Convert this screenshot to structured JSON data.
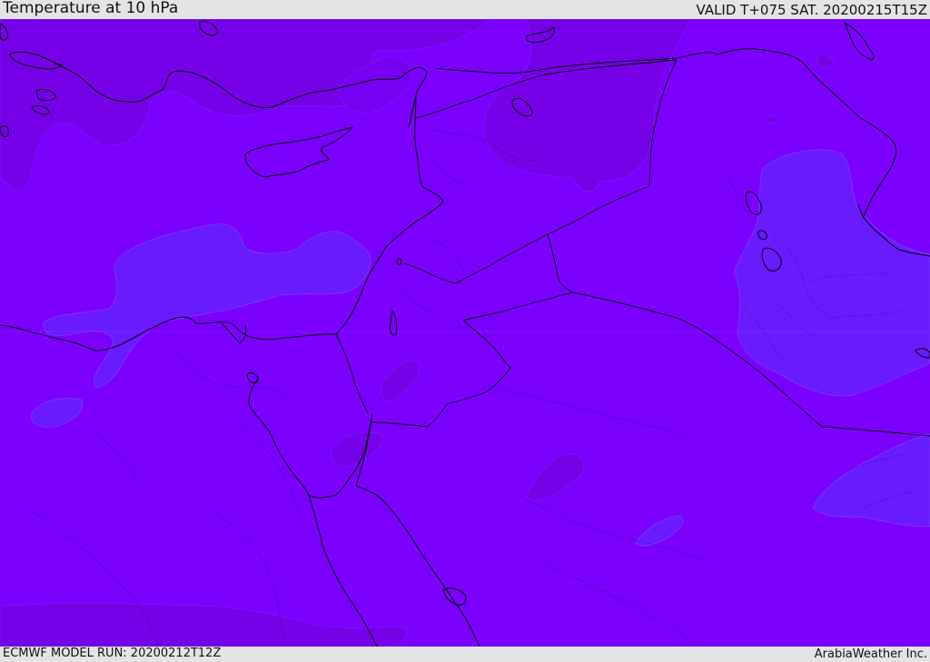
{
  "header": {
    "title": "Temperature at 10 hPa",
    "valid": "VALID T+075 SAT. 20200215T15Z"
  },
  "footer": {
    "model_run": "ECMWF MODEL RUN: 20200212T12Z",
    "credit": "ArabiaWeather Inc."
  },
  "map": {
    "region": "Eastern Mediterranean and Middle East",
    "field": "temperature",
    "colors": {
      "base": "#7b00ff",
      "warmer": "#7600e8",
      "cooler": "#6a1aff",
      "border_line": "#000000"
    }
  }
}
